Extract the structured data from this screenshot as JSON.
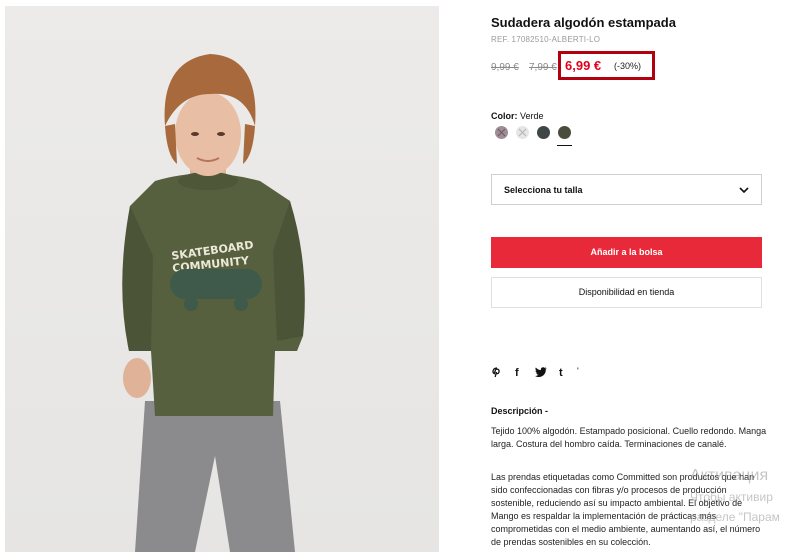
{
  "product": {
    "title": "Sudadera algodón estampada",
    "ref": "REF. 17082510-ALBERTI-LO",
    "old_price_1": "9,99 €",
    "old_price_2": "7,99 €",
    "price": "6,99 €",
    "discount": "(-30%)",
    "sweater_print_line1": "SKATEBOARD",
    "sweater_print_line2": "COMMUNITY"
  },
  "color": {
    "label": "Color:",
    "value": "Verde",
    "swatches": [
      {
        "color": "#a08c94",
        "available": false
      },
      {
        "color": "#e6e6e6",
        "available": false
      },
      {
        "color": "#3f4746",
        "available": true
      },
      {
        "color": "#4a4d3b",
        "available": true,
        "selected": true
      }
    ]
  },
  "size": {
    "placeholder": "Selecciona tu talla",
    "icon": "chevron-down-icon"
  },
  "actions": {
    "add_to_bag": "Añadir a la bolsa",
    "availability": "Disponibilidad en tienda",
    "accent_color": "#e7293a"
  },
  "share": {
    "icons": [
      "pinterest-icon",
      "facebook-icon",
      "twitter-icon",
      "tumblr-icon"
    ],
    "p": "P",
    "f": "f",
    "t": "t",
    "more": "'"
  },
  "description": {
    "heading": "Descripción -",
    "paragraph1": "Tejido 100% algodón. Estampado posicional. Cuello redondo. Manga larga. Costura del hombro caída. Terminaciones de canalé.",
    "paragraph2": "Las prendas etiquetadas como Committed son productos que han sido confeccionadas con fibras y/o procesos de producción sostenible, reduciendo así su impacto ambiental. El objetivo de Mango es respaldar la implementación de prácticas más comprometidas con el medio ambiente, aumentando así, el número de prendas sostenibles en su colección."
  },
  "watermark": {
    "line1": "Активация",
    "line2": "Чтобы активир",
    "line3": "разделе \"Парам"
  }
}
